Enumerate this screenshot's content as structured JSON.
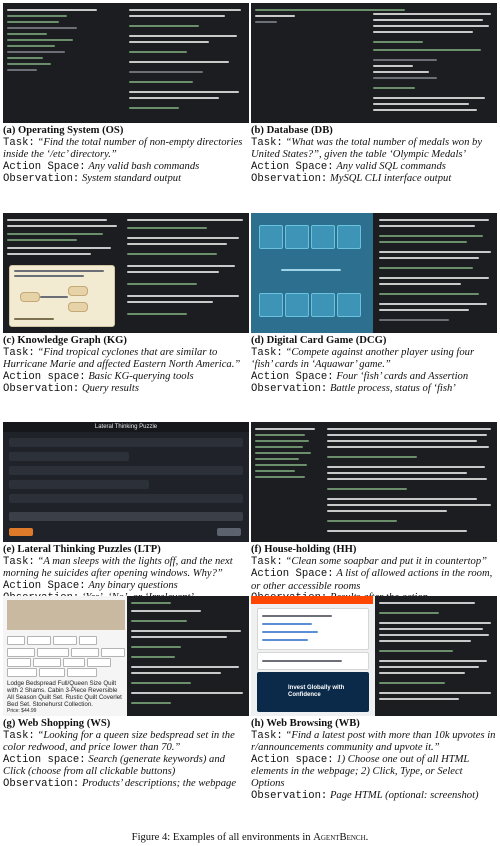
{
  "labels": {
    "task": "Task:",
    "action_space": "Action Space:",
    "action_space_lower": "Action space:",
    "observation": "Observation:"
  },
  "panels": {
    "os": {
      "title": "(a) Operating System (OS)",
      "task": "“Find the total number of non-empty directories inside the ‘/etc’ directory.”",
      "action_space": "Any valid bash commands",
      "observation": "System standard output"
    },
    "db": {
      "title": "(b) Database (DB)",
      "task": "“What was the total number of medals won by United States?”, given the table ‘Olympic Medals’",
      "action_space": "Any valid SQL commands",
      "observation": "MySQL CLI interface output"
    },
    "kg": {
      "title": "(c) Knowledge Graph (KG)",
      "task": "“Find tropical cyclones that are similar to Hurricane Marie and affected Eastern North America.”",
      "action_space": "Basic KG-querying tools",
      "observation": "Query results"
    },
    "dcg": {
      "title": "(d) Digital Card Game (DCG)",
      "task": "“Compete against another player using four ‘fish’ cards in ‘Aquawar’ game.”",
      "action_space": "Four ‘fish’ cards and Assertion",
      "observation": "Battle process, status of ‘fish’"
    },
    "ltp": {
      "title": "(e) Lateral Thinking Puzzles (LTP)",
      "task": "“A man sleeps with the lights off, and the next morning he suicides after opening windows. Why?”",
      "action_space": "Any binary questions",
      "observation": "‘Yes’, ‘No’, or ‘Irrelevant’",
      "screen_title": "Lateral Thinking Puzzle"
    },
    "hh": {
      "title": "(f) House-holding (HH)",
      "task": "“Clean some soapbar and put it in countertop”",
      "action_space": "A list of allowed actions in the room, or other accessible rooms",
      "observation": "Results after the action."
    },
    "ws": {
      "title": "(g) Web Shopping (WS)",
      "task": "“Looking for a queen size bedspread set in the color redwood, and price lower than 70.”",
      "action_space": "Search (generate keywords) and Click (choose from all clickable buttons)",
      "observation": "Products’ descriptions; the webpage",
      "product_text": "Lodge Bedspread Full/Queen Size Quilt with 2 Shams. Cabin 3-Piece Reversible All Season Quilt Set. Rustic Quilt Coverlet Bed Set. Stonehurst Collection.",
      "price": "Price: $44.99"
    },
    "wb": {
      "title": "(h) Web Browsing (WB)",
      "task": "“Find a latest post with more than 10k upvotes in r/announcements community and upvote it.”",
      "action_space": "1) Choose one out of all HTML elements in the webpage; 2) Click, Type, or Select Options",
      "observation": "Page HTML (optional: screenshot)",
      "card_title": "Invest Globally with Confidence"
    }
  },
  "figure_caption": {
    "prefix": "Figure 4: Examples of all environments in ",
    "name": "AgentBench",
    "suffix": "."
  }
}
